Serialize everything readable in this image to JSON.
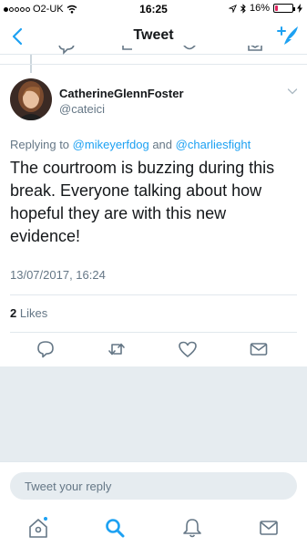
{
  "status_bar": {
    "carrier": "O2-UK",
    "time": "16:25",
    "battery": "16%",
    "battery_level": 0.16,
    "signal_filled": 1,
    "signal_total": 5
  },
  "nav": {
    "title": "Tweet"
  },
  "tweet": {
    "display_name": "CatherineGlennFoster",
    "handle": "@cateici",
    "replying_prefix": "Replying to",
    "replying_to_1": "@mikeyerfdog",
    "replying_and": "and",
    "replying_to_2": "@charliesfight",
    "text": "The courtroom is buzzing during this break. Everyone talking about how hopeful they are with this new evidence!",
    "timestamp": "13/07/2017, 16:24",
    "likes_count": "2",
    "likes_label": "Likes"
  },
  "reply": {
    "placeholder": "Tweet your reply"
  },
  "icons": {
    "back": "chevron-left-icon",
    "compose": "compose-tweet-icon",
    "caret": "chevron-down-icon",
    "reply": "reply-icon",
    "retweet": "retweet-icon",
    "like": "heart-icon",
    "dm": "envelope-icon",
    "home": "home-icon",
    "search": "search-icon",
    "notifications": "bell-icon",
    "messages": "envelope-icon"
  },
  "colors": {
    "accent": "#1da1f2",
    "text": "#14171a",
    "muted": "#657786",
    "icon": "#657786",
    "divider": "#e1e8ed",
    "background_gray": "#e6ecf0",
    "battery_low": "#e0245e"
  }
}
